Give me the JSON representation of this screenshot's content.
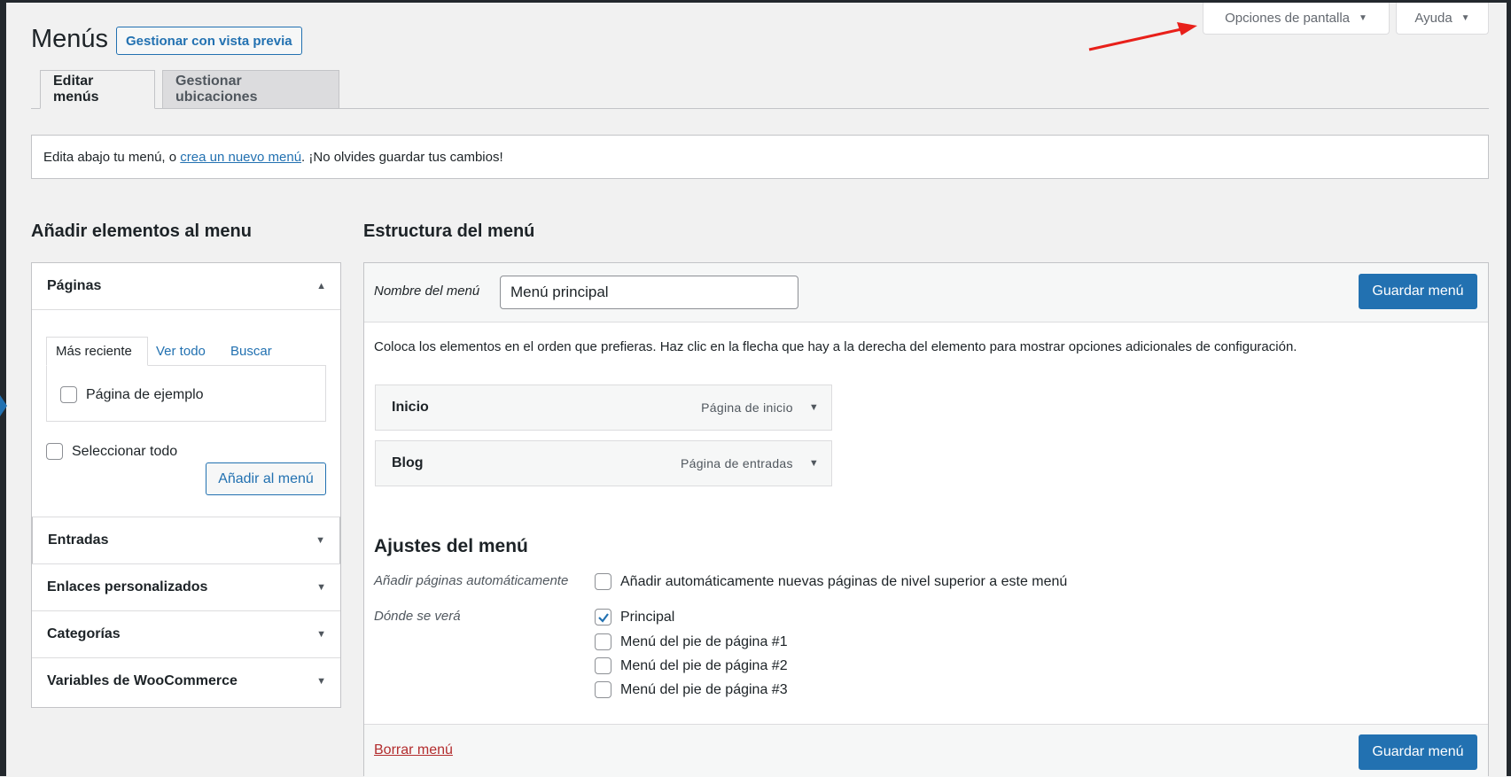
{
  "screen_meta": {
    "opciones_label": "Opciones de pantalla",
    "ayuda_label": "Ayuda"
  },
  "header": {
    "title": "Menús",
    "preview_button": "Gestionar con vista previa"
  },
  "tabs": [
    {
      "label": "Editar menús",
      "active": true
    },
    {
      "label": "Gestionar ubicaciones",
      "active": false
    }
  ],
  "notice": {
    "before": "Edita abajo tu menú, o ",
    "link": "crea un nuevo menú",
    "after": ". ¡No olvides guardar tus cambios!"
  },
  "left": {
    "heading": "Añadir elementos al menu",
    "paginas": {
      "title": "Páginas",
      "tabs": [
        "Más reciente",
        "Ver todo",
        "Buscar"
      ],
      "items": [
        "Página de ejemplo"
      ],
      "select_all": "Seleccionar todo",
      "add_button": "Añadir al menú"
    },
    "sections": [
      "Entradas",
      "Enlaces personalizados",
      "Categorías",
      "Variables de WooCommerce"
    ]
  },
  "right": {
    "heading": "Estructura del menú",
    "name_label": "Nombre del menú",
    "name_value": "Menú principal",
    "save_label": "Guardar menú",
    "instructions": "Coloca los elementos en el orden que prefieras. Haz clic en la flecha que hay a la derecha del elemento para mostrar opciones adicionales de configuración.",
    "items": [
      {
        "title": "Inicio",
        "type": "Página de inicio"
      },
      {
        "title": "Blog",
        "type": "Página de entradas"
      }
    ],
    "settings": {
      "heading": "Ajustes del menú",
      "auto_label": "Añadir páginas automáticamente",
      "auto_option": "Añadir automáticamente nuevas páginas de nivel superior a este menú",
      "auto_checked": false,
      "where_label": "Dónde se verá",
      "locations": [
        {
          "label": "Principal",
          "checked": true
        },
        {
          "label": "Menú del pie de página #1",
          "checked": false
        },
        {
          "label": "Menú del pie de página #2",
          "checked": false
        },
        {
          "label": "Menú del pie de página #3",
          "checked": false
        }
      ]
    },
    "delete_label": "Borrar menú"
  },
  "colors": {
    "accent": "#2271b1",
    "danger": "#b32d2e",
    "annotation_arrow": "#e8201a"
  },
  "icons": {
    "dropdown": "caret-down-icon",
    "collapse": "caret-up-icon",
    "check": "checkmark-icon"
  }
}
